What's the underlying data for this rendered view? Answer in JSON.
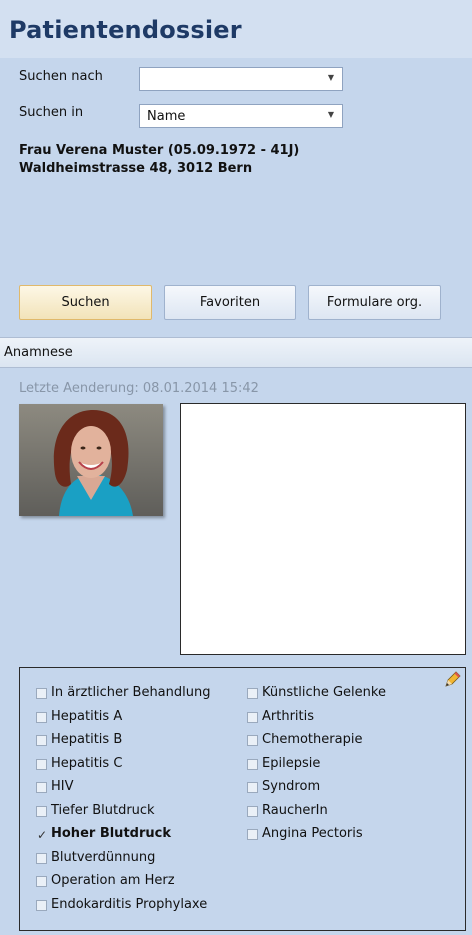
{
  "title": "Patientendossier",
  "search": {
    "suchen_nach_label": "Suchen nach",
    "suchen_nach_value": "",
    "suchen_in_label": "Suchen in",
    "suchen_in_value": "Name"
  },
  "patient": {
    "line1": "Frau Verena Muster (05.09.1972 - 41J)",
    "line2": "Waldheimstrasse 48, 3012 Bern"
  },
  "buttons": {
    "suchen": "Suchen",
    "favoriten": "Favoriten",
    "formulare": "Formulare org."
  },
  "section": {
    "title": "Anamnese",
    "last_change": "Letzte Aenderung: 08.01.2014 15:42"
  },
  "conditions_left": [
    {
      "label": "In ärztlicher Behandlung",
      "checked": false
    },
    {
      "label": "Hepatitis A",
      "checked": false
    },
    {
      "label": "Hepatitis B",
      "checked": false
    },
    {
      "label": "Hepatitis C",
      "checked": false
    },
    {
      "label": "HIV",
      "checked": false
    },
    {
      "label": "Tiefer Blutdruck",
      "checked": false
    },
    {
      "label": "Hoher Blutdruck",
      "checked": true
    },
    {
      "label": "Blutverdünnung",
      "checked": false
    },
    {
      "label": "Operation am Herz",
      "checked": false
    },
    {
      "label": "Endokarditis Prophylaxe",
      "checked": false
    }
  ],
  "conditions_right": [
    {
      "label": "Künstliche Gelenke",
      "checked": false
    },
    {
      "label": "Arthritis",
      "checked": false
    },
    {
      "label": "Chemotherapie",
      "checked": false
    },
    {
      "label": "Epilepsie",
      "checked": false
    },
    {
      "label": "Syndrom",
      "checked": false
    },
    {
      "label": "RaucherIn",
      "checked": false
    },
    {
      "label": "Angina Pectoris",
      "checked": false
    }
  ],
  "icons": {
    "edit": "pencil-icon",
    "dropdown": "chevron-down-icon"
  }
}
